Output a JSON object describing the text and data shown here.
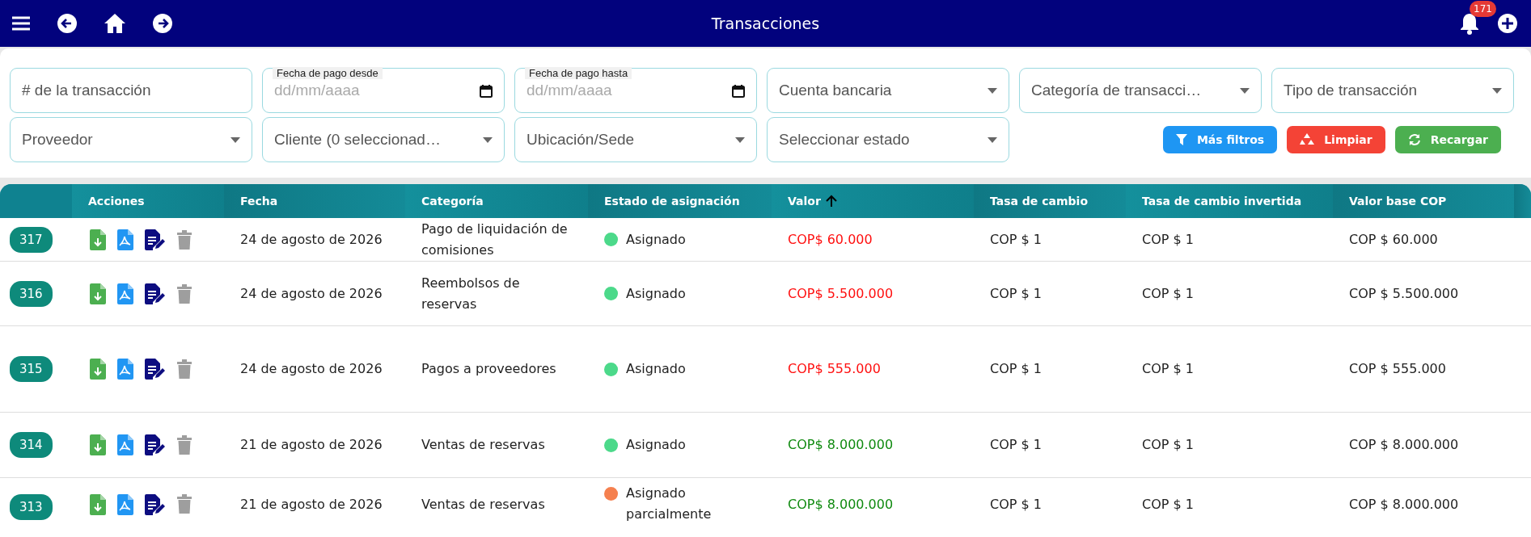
{
  "topbar": {
    "title": "Transacciones",
    "notifications": "171"
  },
  "filters": [
    {
      "kind": "text",
      "placeholder": "# de la transacción"
    },
    {
      "kind": "date",
      "label": "Fecha de pago desde",
      "placeholder": "dd/mm/aaaa"
    },
    {
      "kind": "date",
      "label": "Fecha de pago hasta",
      "placeholder": "dd/mm/aaaa"
    },
    {
      "kind": "select",
      "placeholder": "Cuenta bancaria"
    },
    {
      "kind": "select",
      "placeholder": "Categoría de transacci…"
    },
    {
      "kind": "select",
      "placeholder": "Tipo de transacción"
    },
    {
      "kind": "select",
      "placeholder": "Proveedor"
    },
    {
      "kind": "select",
      "placeholder": "Cliente (0 seleccionad…"
    },
    {
      "kind": "select",
      "placeholder": "Ubicación/Sede"
    },
    {
      "kind": "select",
      "placeholder": "Seleccionar estado"
    }
  ],
  "buttons": [
    {
      "kind": "filter",
      "label": "Más filtros"
    },
    {
      "kind": "clear",
      "label": "Limpiar"
    },
    {
      "kind": "reload",
      "label": "Recargar"
    }
  ],
  "table": {
    "columns": [
      {
        "label": "Acciones",
        "sorted": false
      },
      {
        "label": "Fecha",
        "sorted": false
      },
      {
        "label": "Categoría",
        "sorted": false
      },
      {
        "label": "Estado de asignación",
        "sorted": false
      },
      {
        "label": "Valor",
        "sorted": true
      },
      {
        "label": "Tasa de cambio",
        "sorted": false
      },
      {
        "label": "Tasa de cambio invertida",
        "sorted": false
      },
      {
        "label": "Valor base COP",
        "sorted": false
      }
    ],
    "rows": [
      {
        "id": "317",
        "fecha": "24 de agosto de 2026",
        "categoria": "Pago de liquidación de comisiones",
        "estado": {
          "text": "Asignado",
          "color": "#4cd98a"
        },
        "valor": {
          "text": "COP$ 60.000",
          "color": "#ff1010"
        },
        "tasa": "COP $ 1",
        "tasa_invertida": "COP $ 1",
        "valor_base": "COP $ 60.000"
      },
      {
        "id": "316",
        "fecha": "24 de agosto de 2026",
        "categoria": "Reembolsos de reservas",
        "estado": {
          "text": "Asignado",
          "color": "#4cd98a"
        },
        "valor": {
          "text": "COP$ 5.500.000",
          "color": "#ff1010"
        },
        "tasa": "COP $ 1",
        "tasa_invertida": "COP $ 1",
        "valor_base": "COP $ 5.500.000"
      },
      {
        "id": "315",
        "fecha": "24 de agosto de 2026",
        "categoria": "Pagos a proveedores",
        "estado": {
          "text": "Asignado",
          "color": "#4cd98a"
        },
        "valor": {
          "text": "COP$ 555.000",
          "color": "#ff1010"
        },
        "tasa": "COP $ 1",
        "tasa_invertida": "COP $ 1",
        "valor_base": "COP $ 555.000"
      },
      {
        "id": "314",
        "fecha": "21 de agosto de 2026",
        "categoria": "Ventas de reservas",
        "estado": {
          "text": "Asignado",
          "color": "#4cd98a"
        },
        "valor": {
          "text": "COP$ 8.000.000",
          "color": "#108a10"
        },
        "tasa": "COP $ 1",
        "tasa_invertida": "COP $ 1",
        "valor_base": "COP $ 8.000.000"
      },
      {
        "id": "313",
        "fecha": "21 de agosto de 2026",
        "categoria": "Ventas de reservas",
        "estado": {
          "text": "Asignado parcialmente",
          "color": "#f5804f"
        },
        "valor": {
          "text": "COP$ 8.000.000",
          "color": "#108a10"
        },
        "tasa": "COP $ 1",
        "tasa_invertida": "COP $ 1",
        "valor_base": "COP $ 8.000.000"
      }
    ]
  }
}
